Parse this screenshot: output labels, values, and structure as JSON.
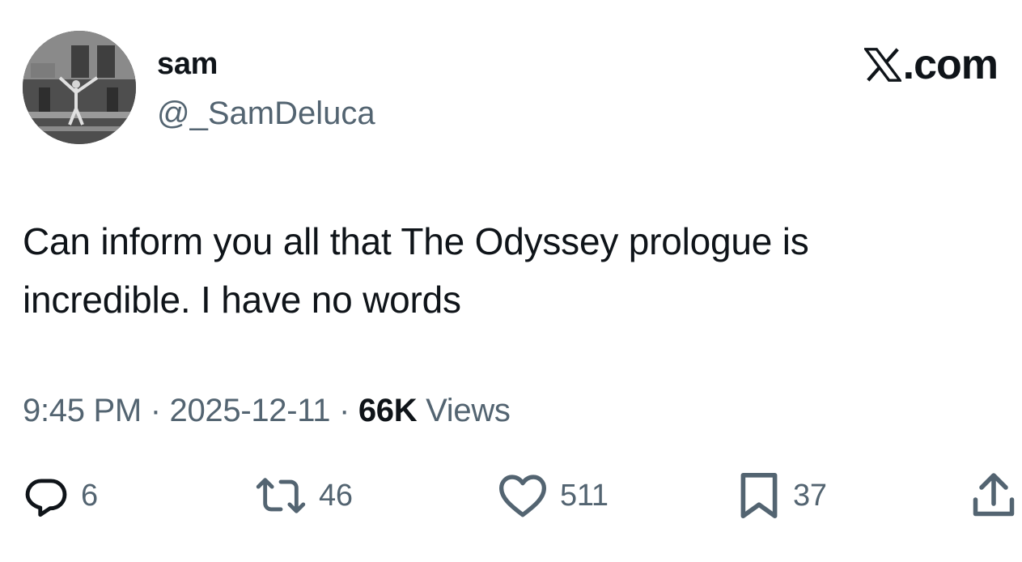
{
  "user": {
    "display_name": "sam",
    "handle": "@_SamDeluca"
  },
  "brand": {
    "text": ".com"
  },
  "tweet": {
    "text_lines": [
      "Can inform you all that The Odyssey prologue is",
      "incredible. I have no words"
    ]
  },
  "meta": {
    "time": "9:45 PM",
    "sep1": " · ",
    "date": "2025-12-11",
    "sep2": " · ",
    "views_count": "66K",
    "views_label": " Views"
  },
  "actions": {
    "replies": "6",
    "reposts": "46",
    "likes": "511",
    "bookmarks": "37"
  },
  "icons": {
    "reply": "reply-icon",
    "repost": "repost-icon",
    "like": "heart-icon",
    "bookmark": "bookmark-icon",
    "share": "share-icon"
  },
  "colors": {
    "text": "#0f1419",
    "muted": "#536471",
    "background": "#ffffff"
  }
}
